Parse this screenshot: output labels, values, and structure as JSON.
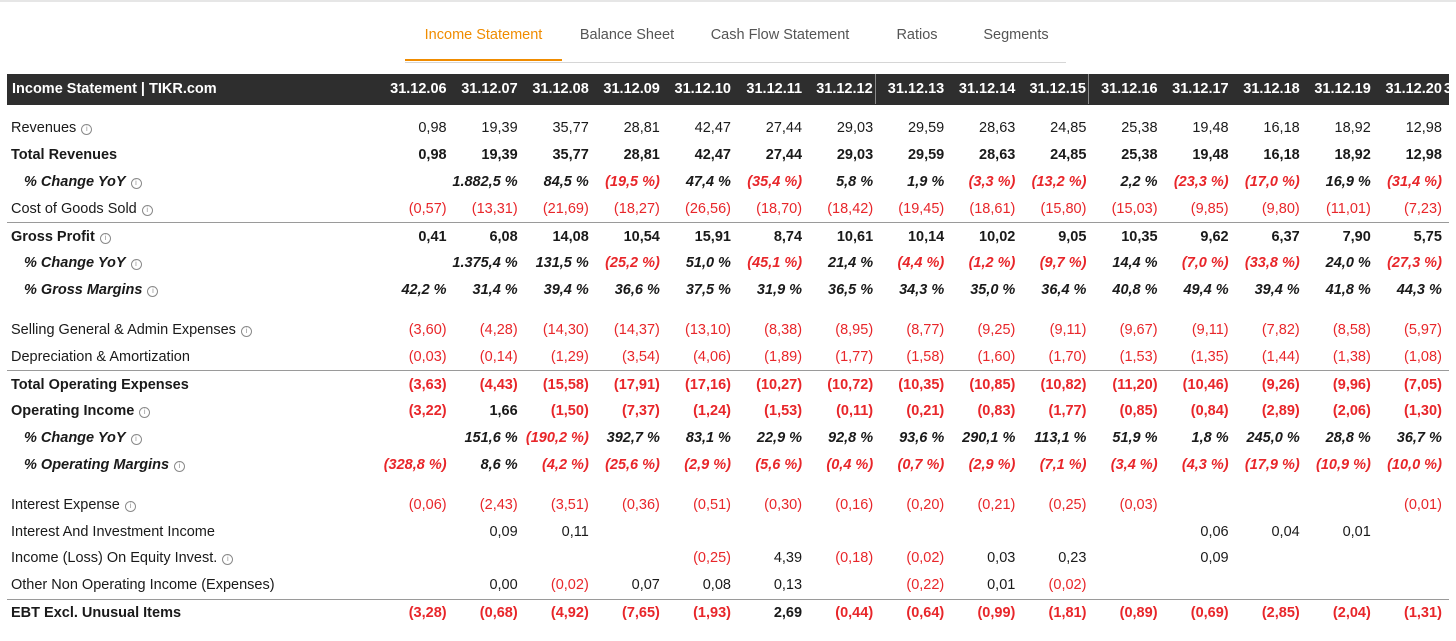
{
  "tabs": [
    {
      "label": "Income Statement",
      "active": true
    },
    {
      "label": "Balance Sheet",
      "active": false
    },
    {
      "label": "Cash Flow Statement",
      "active": false
    },
    {
      "label": "Ratios",
      "active": false
    },
    {
      "label": "Segments",
      "active": false
    }
  ],
  "table": {
    "title": "Income Statement | TIKR.com",
    "columns": [
      "31.12.06",
      "31.12.07",
      "31.12.08",
      "31.12.09",
      "31.12.10",
      "31.12.11",
      "31.12.12",
      "31.12.13",
      "31.12.14",
      "31.12.15",
      "31.12.16",
      "31.12.17",
      "31.12.18",
      "31.12.19",
      "31.12.20",
      "3"
    ],
    "rows": [
      {
        "label": "Revenues",
        "style": "normal",
        "info": true,
        "values": [
          "0,98",
          "19,39",
          "35,77",
          "28,81",
          "42,47",
          "27,44",
          "29,03",
          "29,59",
          "28,63",
          "24,85",
          "25,38",
          "19,48",
          "16,18",
          "18,92",
          "12,98"
        ]
      },
      {
        "label": "Total Revenues",
        "style": "bold",
        "info": false,
        "values": [
          "0,98",
          "19,39",
          "35,77",
          "28,81",
          "42,47",
          "27,44",
          "29,03",
          "29,59",
          "28,63",
          "24,85",
          "25,38",
          "19,48",
          "16,18",
          "18,92",
          "12,98"
        ]
      },
      {
        "label": "% Change YoY",
        "style": "ital",
        "info": true,
        "values": [
          "",
          "1.882,5 %",
          "84,5 %",
          "(19,5 %)",
          "47,4 %",
          "(35,4 %)",
          "5,8 %",
          "1,9 %",
          "(3,3 %)",
          "(13,2 %)",
          "2,2 %",
          "(23,3 %)",
          "(17,0 %)",
          "16,9 %",
          "(31,4 %)"
        ]
      },
      {
        "label": "Cost of Goods Sold",
        "style": "normal",
        "info": true,
        "values": [
          "(0,57)",
          "(13,31)",
          "(21,69)",
          "(18,27)",
          "(26,56)",
          "(18,70)",
          "(18,42)",
          "(19,45)",
          "(18,61)",
          "(15,80)",
          "(15,03)",
          "(9,85)",
          "(9,80)",
          "(11,01)",
          "(7,23)"
        ]
      },
      {
        "label": "Gross Profit",
        "style": "bold",
        "topline": true,
        "info": true,
        "values": [
          "0,41",
          "6,08",
          "14,08",
          "10,54",
          "15,91",
          "8,74",
          "10,61",
          "10,14",
          "10,02",
          "9,05",
          "10,35",
          "9,62",
          "6,37",
          "7,90",
          "5,75"
        ]
      },
      {
        "label": "% Change YoY",
        "style": "ital",
        "info": true,
        "values": [
          "",
          "1.375,4 %",
          "131,5 %",
          "(25,2 %)",
          "51,0 %",
          "(45,1 %)",
          "21,4 %",
          "(4,4 %)",
          "(1,2 %)",
          "(9,7 %)",
          "14,4 %",
          "(7,0 %)",
          "(33,8 %)",
          "24,0 %",
          "(27,3 %)"
        ]
      },
      {
        "label": "% Gross Margins",
        "style": "ital",
        "info": true,
        "values": [
          "42,2 %",
          "31,4 %",
          "39,4 %",
          "36,6 %",
          "37,5 %",
          "31,9 %",
          "36,5 %",
          "34,3 %",
          "35,0 %",
          "36,4 %",
          "40,8 %",
          "49,4 %",
          "39,4 %",
          "41,8 %",
          "44,3 %"
        ]
      },
      {
        "gap": true
      },
      {
        "label": "Selling General & Admin Expenses",
        "style": "normal",
        "info": true,
        "values": [
          "(3,60)",
          "(4,28)",
          "(14,30)",
          "(14,37)",
          "(13,10)",
          "(8,38)",
          "(8,95)",
          "(8,77)",
          "(9,25)",
          "(9,11)",
          "(9,67)",
          "(9,11)",
          "(7,82)",
          "(8,58)",
          "(5,97)"
        ]
      },
      {
        "label": "Depreciation & Amortization",
        "style": "normal",
        "info": false,
        "values": [
          "(0,03)",
          "(0,14)",
          "(1,29)",
          "(3,54)",
          "(4,06)",
          "(1,89)",
          "(1,77)",
          "(1,58)",
          "(1,60)",
          "(1,70)",
          "(1,53)",
          "(1,35)",
          "(1,44)",
          "(1,38)",
          "(1,08)"
        ]
      },
      {
        "label": "Total Operating Expenses",
        "style": "bold",
        "topline": true,
        "info": false,
        "values": [
          "(3,63)",
          "(4,43)",
          "(15,58)",
          "(17,91)",
          "(17,16)",
          "(10,27)",
          "(10,72)",
          "(10,35)",
          "(10,85)",
          "(10,82)",
          "(11,20)",
          "(10,46)",
          "(9,26)",
          "(9,96)",
          "(7,05)"
        ]
      },
      {
        "label": "Operating Income",
        "style": "bold",
        "info": true,
        "values": [
          "(3,22)",
          "1,66",
          "(1,50)",
          "(7,37)",
          "(1,24)",
          "(1,53)",
          "(0,11)",
          "(0,21)",
          "(0,83)",
          "(1,77)",
          "(0,85)",
          "(0,84)",
          "(2,89)",
          "(2,06)",
          "(1,30)"
        ]
      },
      {
        "label": "% Change YoY",
        "style": "ital",
        "info": true,
        "values": [
          "",
          "151,6 %",
          "(190,2 %)",
          "392,7 %",
          "83,1 %",
          "22,9 %",
          "92,8 %",
          "93,6 %",
          "290,1 %",
          "113,1 %",
          "51,9 %",
          "1,8 %",
          "245,0 %",
          "28,8 %",
          "36,7 %"
        ]
      },
      {
        "label": "% Operating Margins",
        "style": "ital",
        "info": true,
        "values": [
          "(328,8 %)",
          "8,6 %",
          "(4,2 %)",
          "(25,6 %)",
          "(2,9 %)",
          "(5,6 %)",
          "(0,4 %)",
          "(0,7 %)",
          "(2,9 %)",
          "(7,1 %)",
          "(3,4 %)",
          "(4,3 %)",
          "(17,9 %)",
          "(10,9 %)",
          "(10,0 %)"
        ]
      },
      {
        "gap": true
      },
      {
        "label": "Interest Expense",
        "style": "normal",
        "info": true,
        "values": [
          "(0,06)",
          "(2,43)",
          "(3,51)",
          "(0,36)",
          "(0,51)",
          "(0,30)",
          "(0,16)",
          "(0,20)",
          "(0,21)",
          "(0,25)",
          "(0,03)",
          "",
          "",
          "",
          "(0,01)"
        ]
      },
      {
        "label": "Interest And Investment Income",
        "style": "normal",
        "info": false,
        "values": [
          "",
          "0,09",
          "0,11",
          "",
          "",
          "",
          "",
          "",
          "",
          "",
          "",
          "0,06",
          "0,04",
          "0,01",
          ""
        ]
      },
      {
        "label": "Income (Loss) On Equity Invest.",
        "style": "normal",
        "info": true,
        "values": [
          "",
          "",
          "",
          "",
          "(0,25)",
          "4,39",
          "(0,18)",
          "(0,02)",
          "0,03",
          "0,23",
          "",
          "0,09",
          "",
          "",
          ""
        ]
      },
      {
        "label": "Other Non Operating Income (Expenses)",
        "style": "normal",
        "info": false,
        "values": [
          "",
          "0,00",
          "(0,02)",
          "0,07",
          "0,08",
          "0,13",
          "",
          "(0,22)",
          "0,01",
          "(0,02)",
          "",
          "",
          "",
          "",
          ""
        ]
      },
      {
        "label": "EBT Excl. Unusual Items",
        "style": "bold",
        "topline": true,
        "info": false,
        "values": [
          "(3,28)",
          "(0,68)",
          "(4,92)",
          "(7,65)",
          "(1,93)",
          "2,69",
          "(0,44)",
          "(0,64)",
          "(0,99)",
          "(1,81)",
          "(0,89)",
          "(0,69)",
          "(2,85)",
          "(2,04)",
          "(1,31)"
        ]
      }
    ]
  },
  "colors": {
    "accent": "#f08c00",
    "negative": "#e8262a",
    "header_bg": "#2e2e2e"
  },
  "icons": {
    "info": "info-circle-icon"
  }
}
